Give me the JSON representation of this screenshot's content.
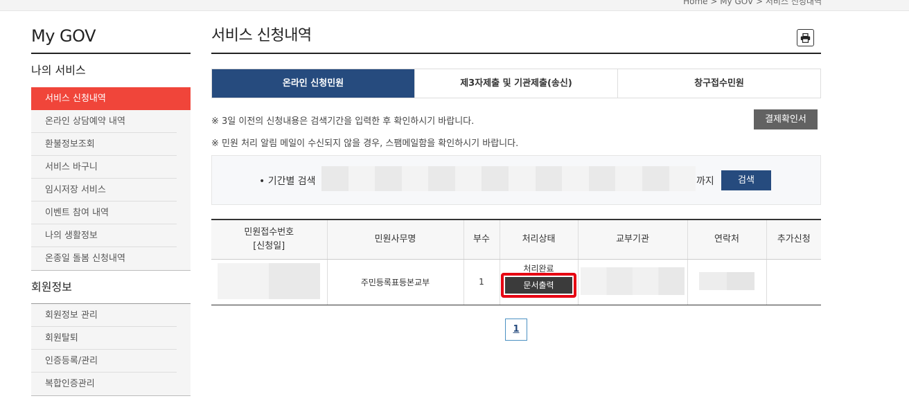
{
  "breadcrumb": "Home > My GOV > 서비스 신청내역",
  "sidebar": {
    "title": "My GOV",
    "section1_title": "나의 서비스",
    "section1_items": [
      "서비스 신청내역",
      "온라인 상담예약 내역",
      "환불정보조회",
      "서비스 바구니",
      "임시저장 서비스",
      "이벤트 참여 내역",
      "나의 생활정보",
      "온종일 돌봄 신청내역"
    ],
    "section2_title": "회원정보",
    "section2_items": [
      "회원정보 관리",
      "회원탈퇴",
      "인증등록/관리",
      "복합인증관리"
    ]
  },
  "main": {
    "title": "서비스 신청내역",
    "tabs": [
      "온라인 신청민원",
      "제3자제출 및 기관제출(송신)",
      "창구접수민원"
    ],
    "notice1": "※ 3일 이전의 신청내용은 검색기간을 입력한 후 확인하시기 바랍니다.",
    "notice2": "※ 민원 처리 알림 메일이 수신되지 않을 경우, 스팸메일함을 확인하시기 바랍니다.",
    "payment_button": "결제확인서",
    "search_label": "• 기간별 검색",
    "until_label": "까지",
    "search_button": "검색"
  },
  "table": {
    "headers": [
      "민원접수번호",
      "[신청일]",
      "민원사무명",
      "부수",
      "처리상태",
      "교부기관",
      "연락처",
      "추가신청"
    ],
    "row": {
      "service_name": "주민등록표등본교부",
      "copies": "1",
      "status": "처리완료",
      "print_button": "문서출력"
    }
  },
  "pagination": {
    "current": "1"
  },
  "colors": {
    "accent_red": "#f0453a",
    "navy": "#264b7e",
    "highlight": "#e60012"
  }
}
